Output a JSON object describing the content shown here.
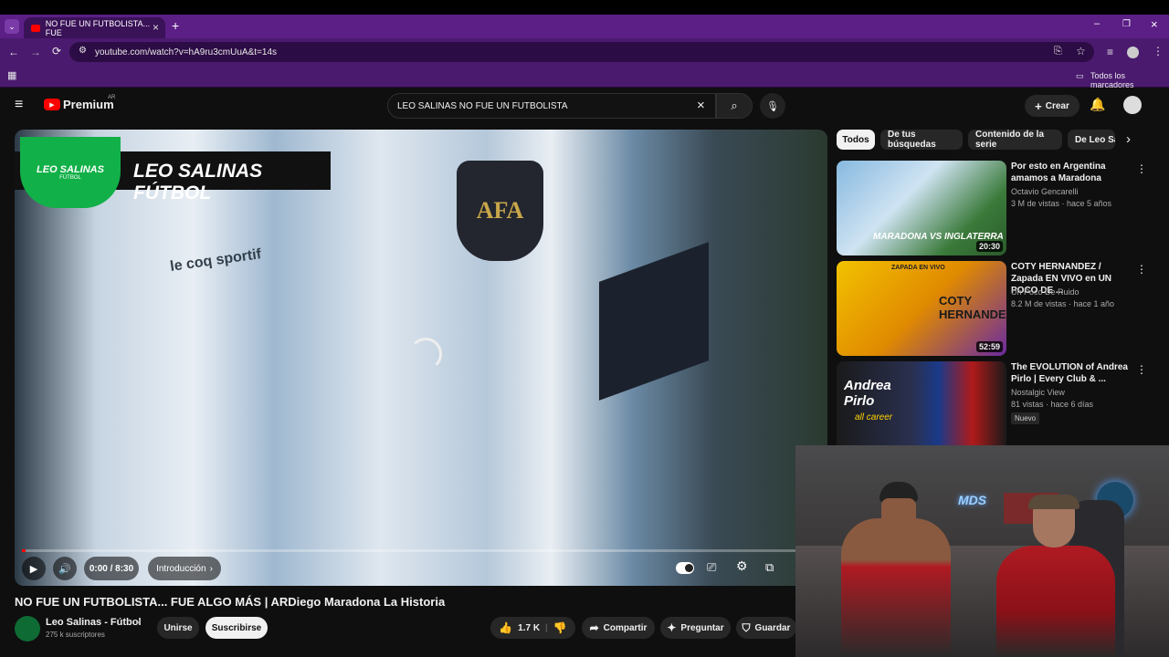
{
  "browser": {
    "tab_title": "NO FUE UN FUTBOLISTA... FUE",
    "url": "youtube.com/watch?v=hA9ru3cmUuA&t=14s",
    "bookmarks_label": "Todos los marcadores"
  },
  "header": {
    "brand": "Premium",
    "region": "AR",
    "search_value": "LEO SALINAS NO FUE UN FUTBOLISTA",
    "create_label": "Crear"
  },
  "player": {
    "banner_text": "LEO SALINAS FÚTBOL",
    "logo_text": "LEO SALINAS",
    "logo_sub": "FÚTBOL",
    "crest_text": "AFA",
    "brand_text": "le coq sportif",
    "time": "0:00 / 8:30",
    "chapter": "Introducción",
    "progress_fraction": 0.0
  },
  "video": {
    "title": "NO FUE UN FUTBOLISTA... FUE ALGO MÁS | ARDiego Maradona La Historia",
    "channel_name": "Leo Salinas - Fútbol",
    "subscribers": "275 k suscriptores",
    "join_label": "Unirse",
    "subscribe_label": "Suscribirse",
    "likes": "1.7 K",
    "share_label": "Compartir",
    "ask_label": "Preguntar",
    "save_label": "Guardar"
  },
  "chips": [
    "Todos",
    "De tus búsquedas",
    "Contenido de la serie",
    "De Leo Sa"
  ],
  "recommendations": [
    {
      "title": "Por esto en Argentina amamos a Maradona",
      "channel": "Octavio Gencarelli",
      "meta": "3 M de vistas · hace 5 años",
      "duration": "20:30",
      "thumb_text": "MARADONA VS INGLATERRA",
      "badge": ""
    },
    {
      "title": "COTY HERNANDEZ / Zapada EN VIVO en UN POCO DE ...",
      "channel": "Un Poco De Ruido",
      "meta": "8.2 M de vistas · hace 1 año",
      "duration": "52:59",
      "thumb_text": "COTY HERNANDEZ",
      "thumb_top": "ZAPADA EN VIVO",
      "badge": ""
    },
    {
      "title": "The EVOLUTION of Andrea Pirlo | Every Club & ...",
      "channel": "Nostalgic View",
      "meta": "81 vistas · hace 6 días",
      "duration": "",
      "thumb_text": "Andrea Pirlo",
      "thumb_sub": "all career",
      "badge": "Nuevo"
    }
  ],
  "webcam": {
    "sign_text": "MDS"
  }
}
